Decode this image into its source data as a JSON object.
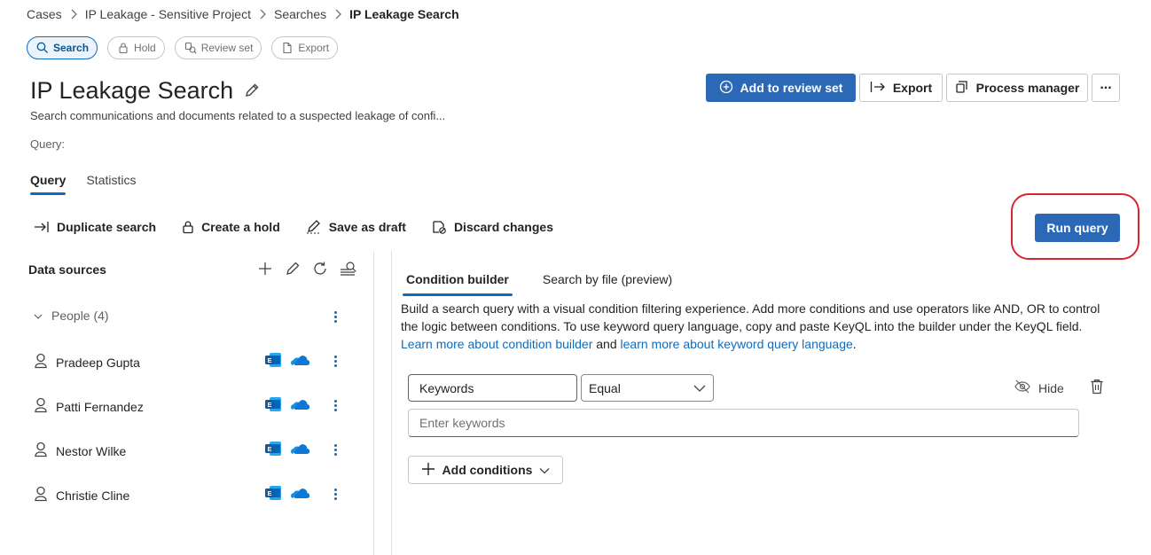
{
  "breadcrumb": {
    "items": [
      "Cases",
      "IP Leakage - Sensitive Project",
      "Searches",
      "IP Leakage Search"
    ]
  },
  "pills": [
    {
      "label": "Search",
      "icon": "search-icon",
      "active": true
    },
    {
      "label": "Hold",
      "icon": "lock-icon",
      "active": false
    },
    {
      "label": "Review set",
      "icon": "review-set-icon",
      "active": false
    },
    {
      "label": "Export",
      "icon": "document-icon",
      "active": false
    }
  ],
  "page": {
    "title": "IP Leakage Search",
    "subtitle": "Search communications and documents related to a suspected leakage of confi...",
    "query_label": "Query:"
  },
  "actions": {
    "add_to_review_set": "Add to review set",
    "export": "Export",
    "process_manager": "Process manager",
    "more": "..."
  },
  "tabs": [
    {
      "label": "Query",
      "active": true
    },
    {
      "label": "Statistics",
      "active": false
    }
  ],
  "command_bar": {
    "duplicate": "Duplicate search",
    "create_hold": "Create a hold",
    "save_draft": "Save as draft",
    "discard": "Discard changes",
    "run_query": "Run query"
  },
  "data_sources": {
    "title": "Data sources",
    "group_label": "People (4)",
    "people": [
      {
        "name": "Pradeep Gupta"
      },
      {
        "name": "Patti Fernandez"
      },
      {
        "name": "Nestor Wilke"
      },
      {
        "name": "Christie Cline"
      }
    ]
  },
  "builder": {
    "tabs": [
      {
        "label": "Condition builder",
        "active": true
      },
      {
        "label": "Search by file (preview)",
        "active": false
      }
    ],
    "description_text": "Build a search query with a visual condition filtering experience. Add more conditions and use operators like AND, OR to control the logic between conditions. To use keyword query language, copy and paste KeyQL into the builder under the KeyQL field.",
    "link1": "Learn more about condition builder",
    "and_text": "and",
    "link2": "learn more about keyword query language",
    "period": ".",
    "condition_field": "Keywords",
    "operator": "Equal",
    "hide_label": "Hide",
    "keywords_placeholder": "Enter keywords",
    "add_conditions": "Add conditions"
  },
  "colors": {
    "accent": "#0f6cbd",
    "primary_button": "#2b68b5",
    "highlight_ring": "#d9232f"
  }
}
